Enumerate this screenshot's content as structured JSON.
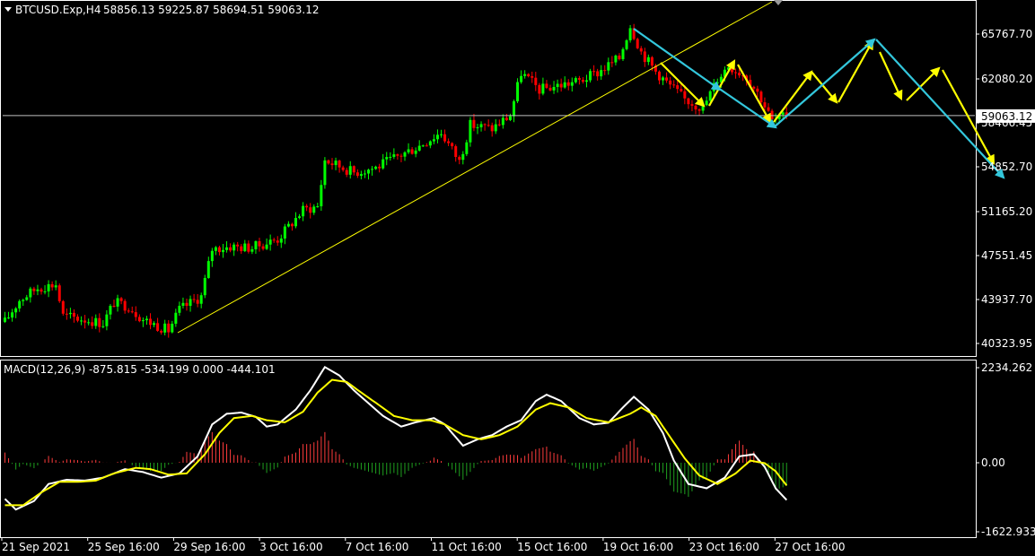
{
  "header": {
    "symbol_text": "BTCUSD.Exp,H4",
    "ohlc_text": "58856.13 59225.87 58694.51 59063.12"
  },
  "macd_header": {
    "text": "MACD(12,26,9) -875.815 -534.199 0.000 -444.101"
  },
  "colors": {
    "background": "#000000",
    "bull_candle": "#00ff00",
    "bear_candle": "#ff0000",
    "trendline": "#ffff00",
    "projection_yellow": "#ffff00",
    "projection_cyan": "#33c7dc",
    "macd_line": "#ffffff",
    "signal_line": "#ffff00",
    "hist_pos": "#ff3c3c",
    "hist_neg": "#1fa01f",
    "frame": "#ffffff",
    "bid_line": "#c0c0c0"
  },
  "current_price_label": "59063.12",
  "chart_data": [
    {
      "type": "candlestick",
      "ylim": [
        38800,
        68300
      ],
      "yticks": [
        "65767.70",
        "62080.20",
        "58466.45",
        "54852.70",
        "51165.20",
        "47551.45",
        "43937.70",
        "40323.95"
      ],
      "xticks": [
        "21 Sep 2021",
        "25 Sep 16:00",
        "29 Sep 16:00",
        "3 Oct 16:00",
        "7 Oct 16:00",
        "11 Oct 16:00",
        "15 Oct 16:00",
        "19 Oct 16:00",
        "23 Oct 16:00",
        "27 Oct 16:00"
      ],
      "xlim": [
        0,
        216
      ],
      "bar_count": 216,
      "current_price": 59063.12,
      "anchors": [
        [
          0,
          42100
        ],
        [
          4,
          43900
        ],
        [
          9,
          44900
        ],
        [
          14,
          45200
        ],
        [
          16,
          42600
        ],
        [
          22,
          42300
        ],
        [
          27,
          42000
        ],
        [
          30,
          43700
        ],
        [
          34,
          43400
        ],
        [
          38,
          42300
        ],
        [
          45,
          41400
        ],
        [
          48,
          43100
        ],
        [
          54,
          44200
        ],
        [
          57,
          48100
        ],
        [
          62,
          48300
        ],
        [
          68,
          48200
        ],
        [
          75,
          48900
        ],
        [
          82,
          51300
        ],
        [
          86,
          51600
        ],
        [
          88,
          55400
        ],
        [
          96,
          54400
        ],
        [
          102,
          54800
        ],
        [
          108,
          55700
        ],
        [
          114,
          56600
        ],
        [
          120,
          57700
        ],
        [
          125,
          55300
        ],
        [
          128,
          58300
        ],
        [
          134,
          58000
        ],
        [
          139,
          59100
        ],
        [
          142,
          62600
        ],
        [
          147,
          61200
        ],
        [
          153,
          61600
        ],
        [
          158,
          61900
        ],
        [
          163,
          62600
        ],
        [
          169,
          63800
        ],
        [
          172,
          66500
        ],
        [
          175,
          64300
        ],
        [
          179,
          62700
        ],
        [
          182,
          61800
        ],
        [
          187,
          60400
        ],
        [
          192,
          59700
        ],
        [
          196,
          62100
        ],
        [
          199,
          63200
        ],
        [
          204,
          62300
        ],
        [
          208,
          60500
        ],
        [
          211,
          58600
        ],
        [
          214,
          58900
        ],
        [
          215,
          59063.12
        ]
      ]
    },
    {
      "type": "macd",
      "params": "12,26,9",
      "ylim": [
        -1700,
        2350
      ],
      "yticks": [
        "2234.262",
        "0.00",
        "-1622.933"
      ],
      "macd": [
        [
          0,
          -850
        ],
        [
          3,
          -1100
        ],
        [
          8,
          -900
        ],
        [
          12,
          -500
        ],
        [
          17,
          -400
        ],
        [
          22,
          -420
        ],
        [
          27,
          -350
        ],
        [
          33,
          -150
        ],
        [
          38,
          -220
        ],
        [
          43,
          -350
        ],
        [
          48,
          -250
        ],
        [
          53,
          150
        ],
        [
          57,
          900
        ],
        [
          61,
          1150
        ],
        [
          65,
          1180
        ],
        [
          69,
          1080
        ],
        [
          72,
          850
        ],
        [
          75,
          900
        ],
        [
          80,
          1250
        ],
        [
          84,
          1700
        ],
        [
          88,
          2250
        ],
        [
          92,
          2050
        ],
        [
          96,
          1700
        ],
        [
          100,
          1400
        ],
        [
          104,
          1100
        ],
        [
          109,
          850
        ],
        [
          113,
          950
        ],
        [
          118,
          1050
        ],
        [
          121,
          900
        ],
        [
          126,
          400
        ],
        [
          130,
          550
        ],
        [
          134,
          650
        ],
        [
          138,
          850
        ],
        [
          142,
          1000
        ],
        [
          146,
          1450
        ],
        [
          149,
          1600
        ],
        [
          153,
          1450
        ],
        [
          158,
          1050
        ],
        [
          162,
          900
        ],
        [
          166,
          940
        ],
        [
          170,
          1300
        ],
        [
          173,
          1550
        ],
        [
          177,
          1250
        ],
        [
          181,
          700
        ],
        [
          184,
          50
        ],
        [
          188,
          -500
        ],
        [
          193,
          -600
        ],
        [
          198,
          -350
        ],
        [
          202,
          150
        ],
        [
          206,
          200
        ],
        [
          209,
          -100
        ],
        [
          212,
          -600
        ],
        [
          215,
          -875.815
        ]
      ],
      "signal": [
        [
          0,
          -1000
        ],
        [
          5,
          -1000
        ],
        [
          10,
          -700
        ],
        [
          15,
          -450
        ],
        [
          20,
          -450
        ],
        [
          25,
          -420
        ],
        [
          30,
          -250
        ],
        [
          36,
          -120
        ],
        [
          40,
          -150
        ],
        [
          45,
          -280
        ],
        [
          50,
          -250
        ],
        [
          55,
          200
        ],
        [
          59,
          700
        ],
        [
          63,
          1050
        ],
        [
          68,
          1100
        ],
        [
          72,
          1000
        ],
        [
          77,
          950
        ],
        [
          82,
          1200
        ],
        [
          86,
          1650
        ],
        [
          90,
          1950
        ],
        [
          94,
          1900
        ],
        [
          98,
          1650
        ],
        [
          103,
          1350
        ],
        [
          107,
          1100
        ],
        [
          112,
          1000
        ],
        [
          117,
          1000
        ],
        [
          121,
          900
        ],
        [
          126,
          650
        ],
        [
          131,
          550
        ],
        [
          136,
          650
        ],
        [
          141,
          850
        ],
        [
          146,
          1250
        ],
        [
          150,
          1400
        ],
        [
          155,
          1300
        ],
        [
          160,
          1050
        ],
        [
          166,
          950
        ],
        [
          172,
          1150
        ],
        [
          175,
          1300
        ],
        [
          179,
          1100
        ],
        [
          183,
          600
        ],
        [
          187,
          100
        ],
        [
          191,
          -300
        ],
        [
          196,
          -500
        ],
        [
          201,
          -250
        ],
        [
          205,
          50
        ],
        [
          209,
          -10
        ],
        [
          212,
          -200
        ],
        [
          215,
          -534.199
        ]
      ]
    }
  ]
}
